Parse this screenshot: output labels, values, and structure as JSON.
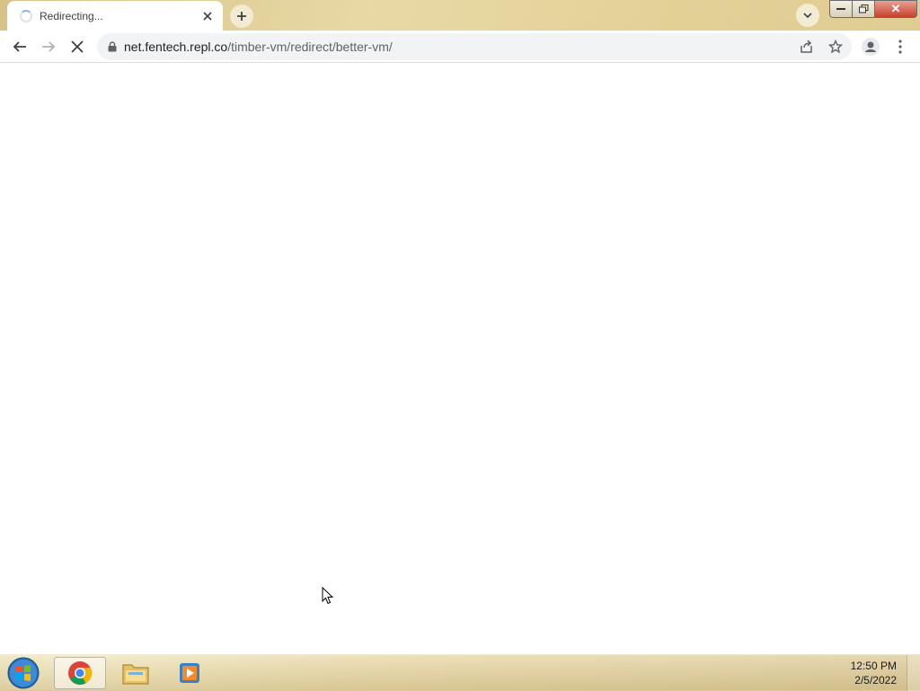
{
  "browser": {
    "tab": {
      "title": "Redirecting..."
    },
    "address": {
      "host": "net.fentech.repl.co",
      "path": "/timber-vm/redirect/better-vm/"
    },
    "window_controls": {
      "close_label": "✕"
    }
  },
  "taskbar": {
    "clock": {
      "time": "12:50 PM",
      "date": "2/5/2022"
    },
    "apps": [
      "chrome",
      "file-explorer",
      "media-player"
    ]
  },
  "icons": {
    "back": "arrow-left-icon",
    "forward": "arrow-right-icon",
    "stop": "stop-x-icon",
    "lock": "lock-icon",
    "share": "share-icon",
    "star": "star-icon",
    "profile": "profile-icon",
    "menu": "kebab-menu-icon"
  },
  "colors": {
    "accent": "#8ab4f8",
    "text": "#202124",
    "muted": "#5f6368"
  }
}
